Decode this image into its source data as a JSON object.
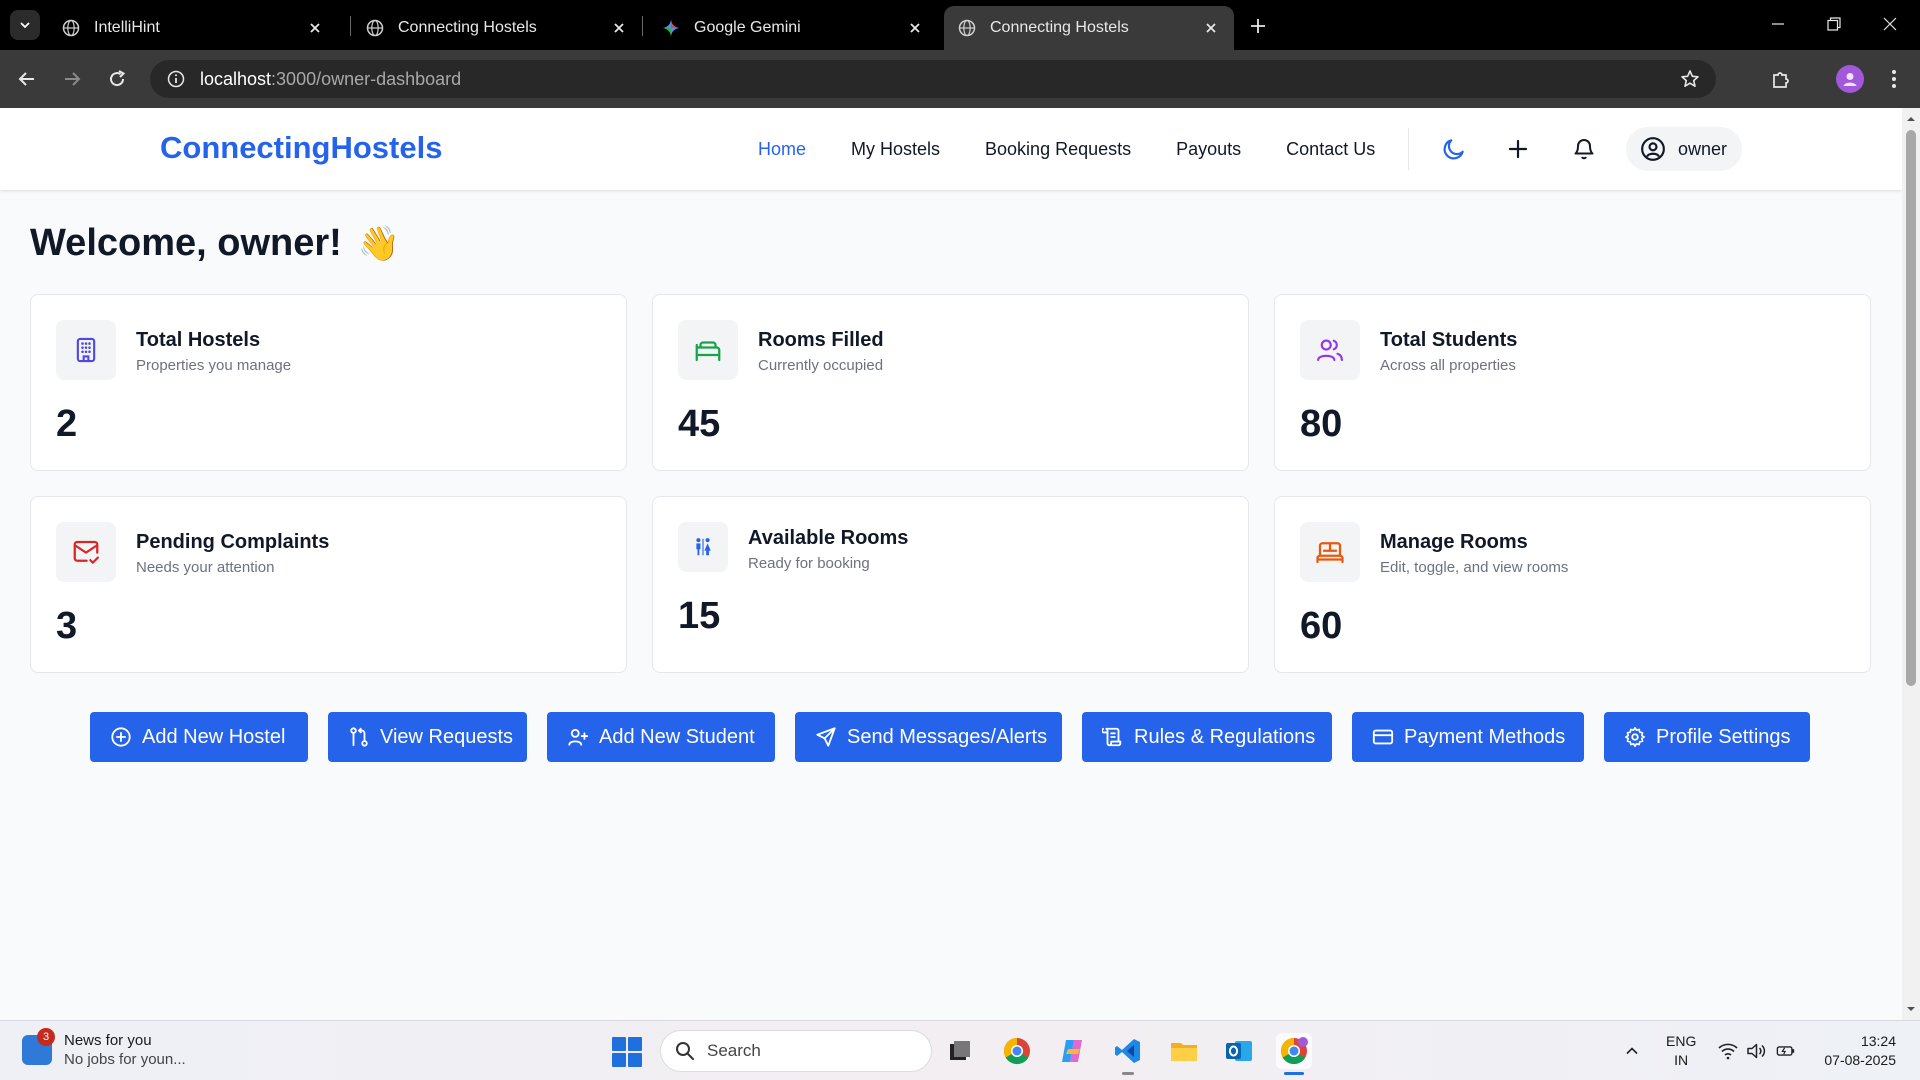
{
  "browser": {
    "tabs": [
      {
        "title": "IntelliHint",
        "favicon": "globe-icon",
        "active": false
      },
      {
        "title": "Connecting Hostels",
        "favicon": "globe-icon",
        "active": false
      },
      {
        "title": "Google Gemini",
        "favicon": "gemini-icon",
        "active": false
      },
      {
        "title": "Connecting Hostels",
        "favicon": "globe-icon",
        "active": true
      }
    ],
    "url_host": "localhost",
    "url_path": ":3000/owner-dashboard"
  },
  "header": {
    "brand": "ConnectingHostels",
    "nav": [
      {
        "label": "Home",
        "active": true
      },
      {
        "label": "My Hostels",
        "active": false
      },
      {
        "label": "Booking Requests",
        "active": false
      },
      {
        "label": "Payouts",
        "active": false
      },
      {
        "label": "Contact Us",
        "active": false
      }
    ],
    "user_name": "owner"
  },
  "main": {
    "welcome": "Welcome, owner!",
    "welcome_emoji": "👋",
    "cards": [
      {
        "title": "Total Hostels",
        "subtitle": "Properties you manage",
        "value": "2",
        "icon": "building-icon",
        "icon_color": "#4f46e5"
      },
      {
        "title": "Rooms Filled",
        "subtitle": "Currently occupied",
        "value": "45",
        "icon": "bed-icon",
        "icon_color": "#16a34a"
      },
      {
        "title": "Total Students",
        "subtitle": "Across all properties",
        "value": "80",
        "icon": "users-icon",
        "icon_color": "#9333ea"
      },
      {
        "title": "Pending Complaints",
        "subtitle": "Needs your attention",
        "value": "3",
        "icon": "mail-check-icon",
        "icon_color": "#dc2626"
      },
      {
        "title": "Available Rooms",
        "subtitle": "Ready for booking",
        "value": "15",
        "icon": "restroom-icon",
        "icon_color": "#2563eb"
      },
      {
        "title": "Manage Rooms",
        "subtitle": "Edit, toggle, and view rooms",
        "value": "60",
        "icon": "bed-double-icon",
        "icon_color": "#ea580c"
      }
    ],
    "actions": [
      {
        "label": "Add New Hostel",
        "icon": "plus-circle-icon"
      },
      {
        "label": "View Requests",
        "icon": "git-pull-request-icon"
      },
      {
        "label": "Add New Student",
        "icon": "user-plus-icon"
      },
      {
        "label": "Send Messages/Alerts",
        "icon": "send-icon"
      },
      {
        "label": "Rules & Regulations",
        "icon": "scroll-icon"
      },
      {
        "label": "Payment Methods",
        "icon": "credit-card-icon"
      },
      {
        "label": "Profile Settings",
        "icon": "gear-icon"
      }
    ]
  },
  "taskbar": {
    "news_title": "News for you",
    "news_subtitle": "No jobs for youn...",
    "news_badge": "3",
    "search_placeholder": "Search",
    "lang_line1": "ENG",
    "lang_line2": "IN",
    "time": "13:24",
    "date": "07-08-2025"
  },
  "colors": {
    "accent": "#2563eb",
    "page_bg": "#f8fafc"
  }
}
